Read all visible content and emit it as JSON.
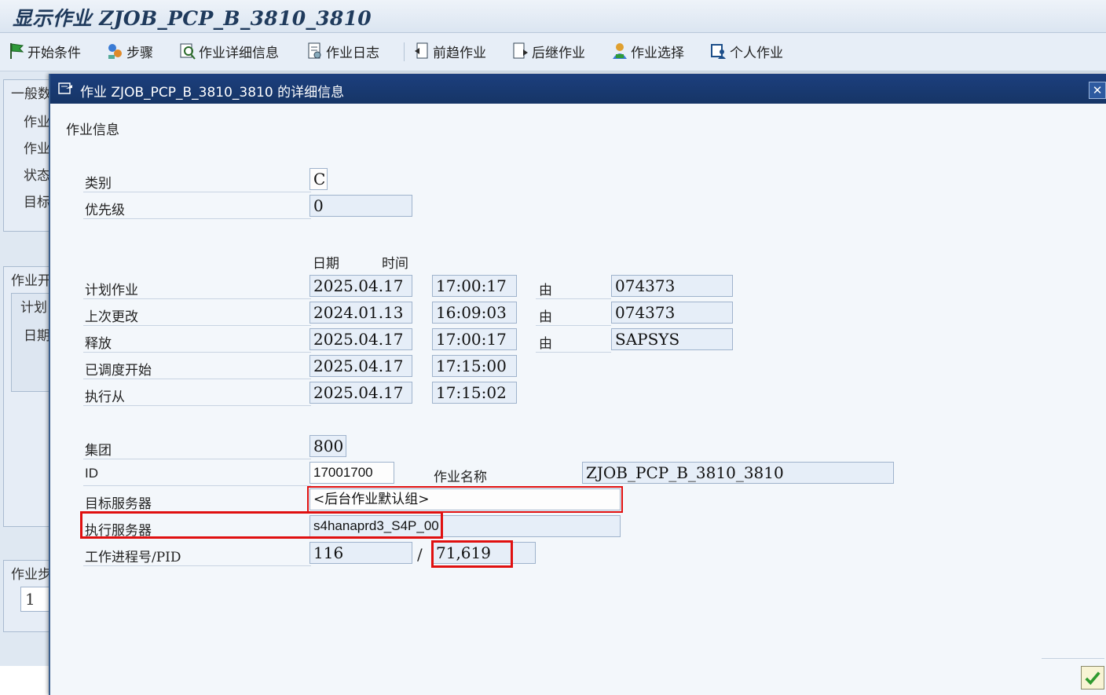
{
  "app": {
    "title": "显示作业 ZJOB_PCP_B_3810_3810"
  },
  "toolbar": {
    "items": [
      {
        "label": "开始条件",
        "icon": "flag-icon"
      },
      {
        "label": "步骤",
        "icon": "steps-icon"
      },
      {
        "label": "作业详细信息",
        "icon": "job-details-icon"
      },
      {
        "label": "作业日志",
        "icon": "job-log-icon"
      },
      {
        "label": "前趋作业",
        "icon": "predecessor-job-icon"
      },
      {
        "label": "后继作业",
        "icon": "successor-job-icon"
      },
      {
        "label": "作业选择",
        "icon": "job-selection-icon"
      },
      {
        "label": "个人作业",
        "icon": "own-jobs-icon"
      }
    ]
  },
  "background": {
    "group1": "一般数",
    "rows": [
      "作业",
      "作业",
      "状态",
      "目标"
    ],
    "group2": "作业开",
    "sub": "计划",
    "date_label": "日期",
    "group3": "作业步",
    "step_value": "1"
  },
  "dialog": {
    "title": "作业 ZJOB_PCP_B_3810_3810 的详细信息",
    "section": "作业信息",
    "category_label": "类别",
    "category_value": "C",
    "priority_label": "优先级",
    "priority_value": "0",
    "col_date": "日期",
    "col_time": "时间",
    "by_label": "由",
    "schedule": [
      {
        "label": "计划作业",
        "date": "2025.04.17",
        "time": "17:00:17",
        "by": "074373"
      },
      {
        "label": "上次更改",
        "date": "2024.01.13",
        "time": "16:09:03",
        "by": "074373"
      },
      {
        "label": "释放",
        "date": "2025.04.17",
        "time": "17:00:17",
        "by": "SAPSYS"
      },
      {
        "label": "已调度开始",
        "date": "2025.04.17",
        "time": "17:15:00"
      },
      {
        "label": "执行从",
        "date": "2025.04.17",
        "time": "17:15:02"
      }
    ],
    "client_label": "集团",
    "client_value": "800",
    "id_label": "ID",
    "id_value": "17001700",
    "jobname_label": "作业名称",
    "jobname_value": "ZJOB_PCP_B_3810_3810",
    "target_server_label": "目标服务器",
    "target_server_value": "<后台作业默认组>",
    "exec_server_label": "执行服务器",
    "exec_server_value": "s4hanaprd3_S4P_00",
    "wp_label": "工作进程号/PID",
    "wp_value": "116",
    "separator": "/",
    "pid_value": "71,619"
  },
  "colors": {
    "dialog_header": "#1c3f7e",
    "highlight": "#e01010"
  }
}
